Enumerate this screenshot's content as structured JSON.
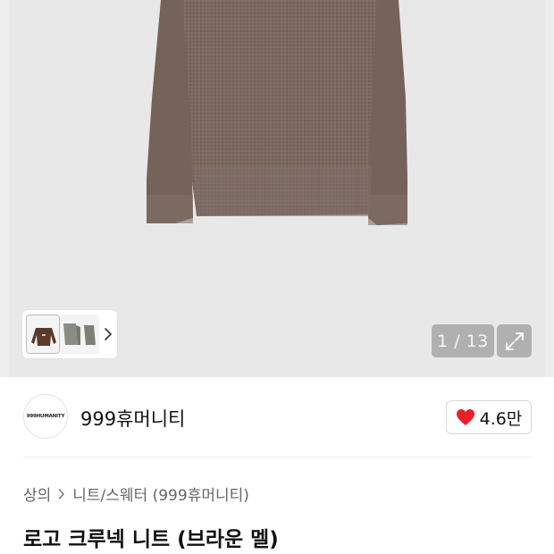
{
  "gallery": {
    "counter": "1 / 13",
    "thumbnails": [
      {
        "name": "front-view",
        "color": "#5a3a2c"
      },
      {
        "name": "side-view",
        "color": "#8a8d86"
      },
      {
        "name": "back-view",
        "color": "#7d7f7a"
      }
    ],
    "product_color": "#7a685f"
  },
  "brand": {
    "logo_text": "999HUMANITY",
    "name": "999휴머니티"
  },
  "like": {
    "count": "4.6만",
    "heart_color": "#e8202a"
  },
  "breadcrumb": {
    "category": "상의",
    "subcategory": "니트/스웨터 (999휴머니티)"
  },
  "product": {
    "title": "로고 크루넥 니트 (브라운 멜)"
  }
}
